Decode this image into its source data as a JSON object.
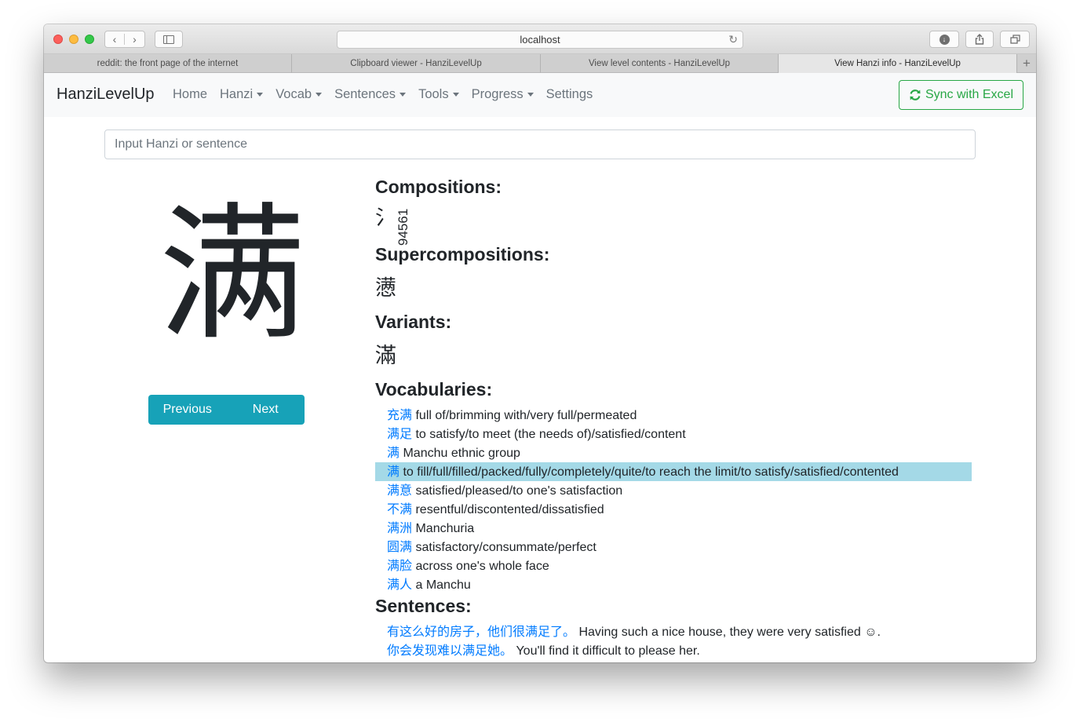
{
  "browser": {
    "url": "localhost",
    "tabs": [
      {
        "title": "reddit: the front page of the internet",
        "active": false
      },
      {
        "title": "Clipboard viewer - HanziLevelUp",
        "active": false
      },
      {
        "title": "View level contents - HanziLevelUp",
        "active": false
      },
      {
        "title": "View Hanzi info - HanziLevelUp",
        "active": true
      }
    ],
    "new_tab_glyph": "+"
  },
  "navbar": {
    "brand": "HanziLevelUp",
    "items": [
      {
        "label": "Home",
        "dropdown": false
      },
      {
        "label": "Hanzi",
        "dropdown": true
      },
      {
        "label": "Vocab",
        "dropdown": true
      },
      {
        "label": "Sentences",
        "dropdown": true
      },
      {
        "label": "Tools",
        "dropdown": true
      },
      {
        "label": "Progress",
        "dropdown": true
      },
      {
        "label": "Settings",
        "dropdown": false
      }
    ],
    "sync_button": "Sync with Excel",
    "sync_icon": "refresh-icon",
    "sync_color": "#28a745"
  },
  "search": {
    "placeholder": "Input Hanzi or sentence",
    "value": ""
  },
  "hanzi": {
    "character": "满"
  },
  "pager": {
    "previous": "Previous",
    "next": "Next",
    "color": "#17a2b8"
  },
  "compositions": {
    "heading": "Compositions:",
    "items": [
      "氵",
      "94561"
    ]
  },
  "supercompositions": {
    "heading": "Supercompositions:",
    "items": [
      "懑"
    ]
  },
  "variants": {
    "heading": "Variants:",
    "items": [
      "滿"
    ]
  },
  "vocabularies": {
    "heading": "Vocabularies:",
    "highlight_color": "#a4d9e7",
    "items": [
      {
        "word": "充满",
        "definition": "full of/brimming with/very full/permeated",
        "highlighted": false
      },
      {
        "word": "满足",
        "definition": "to satisfy/to meet (the needs of)/satisfied/content",
        "highlighted": false
      },
      {
        "word": "满",
        "definition": "Manchu ethnic group",
        "highlighted": false
      },
      {
        "word": "满",
        "definition": "to fill/full/filled/packed/fully/completely/quite/to reach the limit/to satisfy/satisfied/contented",
        "highlighted": true
      },
      {
        "word": "满意",
        "definition": "satisfied/pleased/to one's satisfaction",
        "highlighted": false
      },
      {
        "word": "不满",
        "definition": "resentful/discontented/dissatisfied",
        "highlighted": false
      },
      {
        "word": "满洲",
        "definition": "Manchuria",
        "highlighted": false
      },
      {
        "word": "圆满",
        "definition": "satisfactory/consummate/perfect",
        "highlighted": false
      },
      {
        "word": "满脸",
        "definition": "across one's whole face",
        "highlighted": false
      },
      {
        "word": "满人",
        "definition": "a Manchu",
        "highlighted": false
      }
    ]
  },
  "sentences": {
    "heading": "Sentences:",
    "items": [
      {
        "chinese": "有这么好的房子，他们很满足了。",
        "english": "Having such a nice house, they were very satisfied ☺."
      },
      {
        "chinese": "你会发现难以满足她。",
        "english": "You'll find it difficult to please her."
      }
    ]
  }
}
